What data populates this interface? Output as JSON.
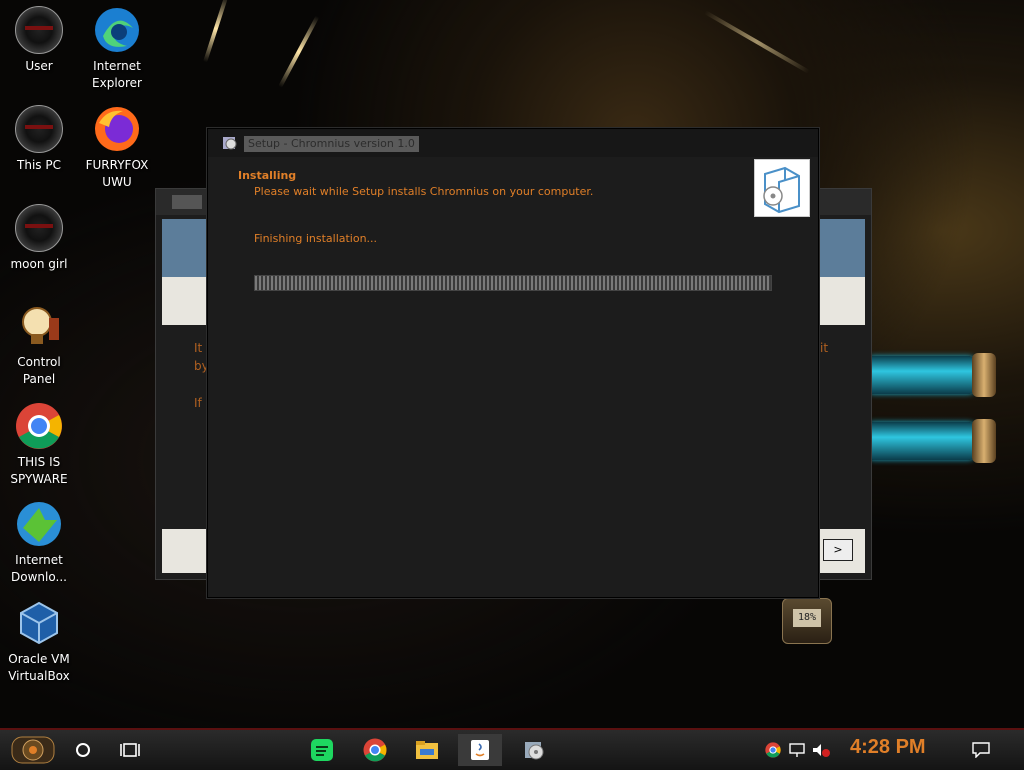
{
  "desktop_icons": [
    {
      "label": "User",
      "icon": "user-disc-icon"
    },
    {
      "label": "Internet Explorer",
      "icon": "edge-icon"
    },
    {
      "label": "This PC",
      "icon": "this-pc-disc-icon"
    },
    {
      "label": "FURRYFOX UWU",
      "icon": "firefox-icon"
    },
    {
      "label": "moon girl",
      "icon": "moon-girl-disc-icon"
    },
    {
      "label": "Control Panel",
      "icon": "lightbulb-icon"
    },
    {
      "label": "THIS IS SPYWARE",
      "icon": "chrome-icon"
    },
    {
      "label": "Internet Downlo...",
      "icon": "idm-icon"
    },
    {
      "label": "Oracle VM VirtualBox",
      "icon": "virtualbox-icon"
    }
  ],
  "setup": {
    "title": "Setup - Chromnius version 1.0",
    "heading": "Installing",
    "subheading": "Please wait while Setup installs Chromnius on your computer.",
    "status": "Finishing installation...",
    "progress": 1.0
  },
  "back_window": {
    "text_1": "It",
    "text_2": "by",
    "text_3": "If",
    "text_4": "it",
    "next_label": ">"
  },
  "gauge": {
    "value": "18%"
  },
  "taskbar": {
    "clock": "4:28 PM",
    "pinned": [
      "start-button",
      "search-circle",
      "task-view",
      "spotify",
      "chrome",
      "file-explorer",
      "java-installer",
      "setup"
    ]
  },
  "colors": {
    "accent_orange": "#e07f28",
    "tube_cyan": "#2fc6e0"
  }
}
